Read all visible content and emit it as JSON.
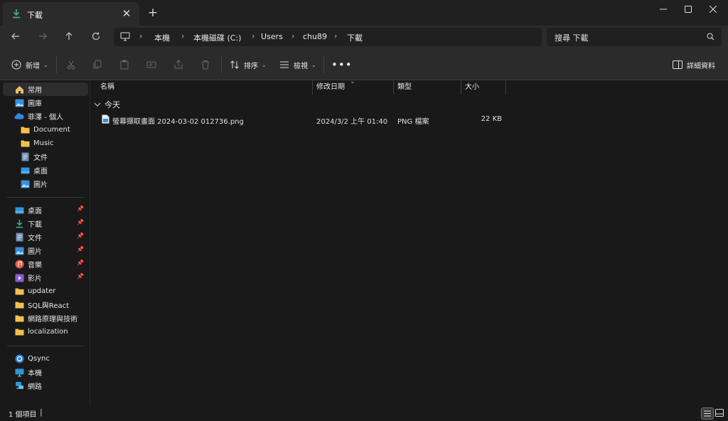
{
  "tab": {
    "title": "下載",
    "icon": "download-icon"
  },
  "window": {
    "minimize_icon": "minimize-icon",
    "maximize_icon": "maximize-icon",
    "close_icon": "close-icon"
  },
  "breadcrumb": [
    "本機",
    "本機磁碟 (C:)",
    "Users",
    "chu89",
    "下載"
  ],
  "search": {
    "placeholder": "搜尋 下載"
  },
  "toolbar": {
    "new_label": "新增",
    "sort_label": "排序",
    "view_label": "檢視",
    "details_label": "詳細資料"
  },
  "sidebar": {
    "quick": [
      {
        "label": "常用",
        "icon": "home-icon"
      },
      {
        "label": "圖庫",
        "icon": "gallery-icon"
      },
      {
        "label": "菲澤 - 個人",
        "icon": "onedrive-icon"
      },
      {
        "label": "Document",
        "icon": "folder-icon"
      },
      {
        "label": "Music",
        "icon": "folder-icon"
      },
      {
        "label": "文件",
        "icon": "document-icon"
      },
      {
        "label": "桌面",
        "icon": "desktop-icon"
      },
      {
        "label": "圖片",
        "icon": "pictures-icon"
      }
    ],
    "pinned": [
      {
        "label": "桌面",
        "icon": "desktop-icon"
      },
      {
        "label": "下載",
        "icon": "download-icon"
      },
      {
        "label": "文件",
        "icon": "document-icon"
      },
      {
        "label": "圖片",
        "icon": "pictures-icon"
      },
      {
        "label": "音樂",
        "icon": "music-icon"
      },
      {
        "label": "影片",
        "icon": "video-icon"
      }
    ],
    "folders": [
      {
        "label": "updater"
      },
      {
        "label": "SQL與React"
      },
      {
        "label": "網路原理與技術"
      },
      {
        "label": "localization"
      }
    ],
    "devices": [
      {
        "label": "Qsync",
        "icon": "qsync-icon"
      },
      {
        "label": "本機",
        "icon": "computer-icon"
      },
      {
        "label": "網路",
        "icon": "network-icon"
      }
    ]
  },
  "columns": {
    "name": "名稱",
    "modified": "修改日期",
    "type": "類型",
    "size": "大小"
  },
  "group": {
    "label": "今天"
  },
  "files": [
    {
      "name": "螢幕擷取畫面 2024-03-02 012736.png",
      "modified": "2024/3/2 上午 01:40",
      "type": "PNG 檔案",
      "size": "22 KB"
    }
  ],
  "status": {
    "count": "1 個項目"
  }
}
